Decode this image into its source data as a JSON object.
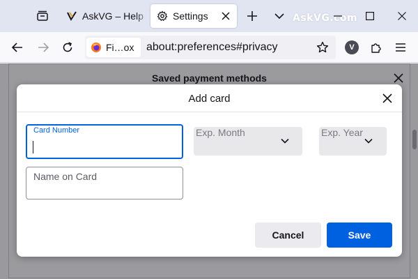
{
  "browser": {
    "tabs": [
      {
        "title": "AskVG – Help",
        "icon": "askvg-favicon"
      },
      {
        "title": "Settings",
        "icon": "gear-icon",
        "active": true
      }
    ],
    "watermark": "AskVG.com",
    "identity_label": "Fi…ox",
    "url": "about:preferences#privacy",
    "extension_letter": "V"
  },
  "background_dialog": {
    "title": "Saved payment methods"
  },
  "dialog": {
    "title": "Add card",
    "card_number_label": "Card Number",
    "card_number_value": "",
    "name_on_card_placeholder": "Name on Card",
    "exp_month_label": "Exp. Month",
    "exp_year_label": "Exp. Year",
    "cancel_label": "Cancel",
    "save_label": "Save"
  },
  "colors": {
    "accent": "#0061e0",
    "tabstrip": "#e1e5f2",
    "dim_overlay": "#9a9a9d"
  }
}
